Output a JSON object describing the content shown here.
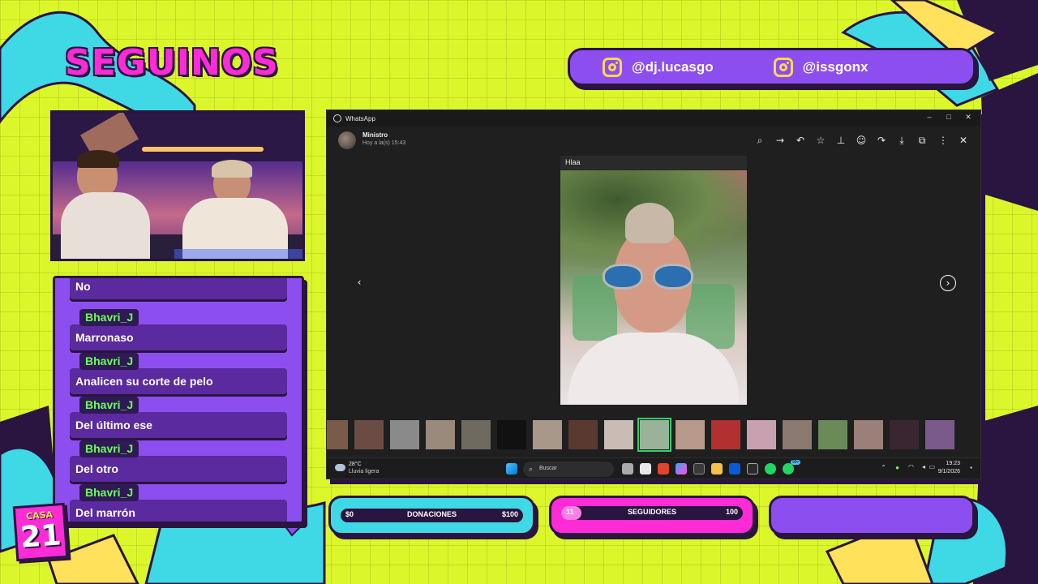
{
  "overlay": {
    "title": "SEGUINOS",
    "socials": [
      {
        "icon": "instagram-icon",
        "handle": "@dj.lucasgo"
      },
      {
        "icon": "instagram-icon",
        "handle": "@issgonx"
      }
    ],
    "logo": {
      "top": "CASA",
      "number": "21"
    }
  },
  "chat": {
    "messages": [
      {
        "user": "",
        "text": "No"
      },
      {
        "user": "Bhavri_J",
        "text": "Marronaso"
      },
      {
        "user": "Bhavri_J",
        "text": "Analicen su corte de pelo"
      },
      {
        "user": "Bhavri_J",
        "text": "Del último ese"
      },
      {
        "user": "Bhavri_J",
        "text": "Del otro"
      },
      {
        "user": "Bhavri_J",
        "text": "Del marrón"
      }
    ]
  },
  "whatsapp": {
    "window_title": "WhatsApp",
    "window_controls": {
      "minimize": "–",
      "maximize": "□",
      "close": "✕"
    },
    "contact_name": "Ministro",
    "timestamp": "Hoy a la(s) 15:43",
    "caption": "Hlaa",
    "toolbar_icons": [
      "zoom-in-icon",
      "forward-arrow-icon",
      "reply-icon",
      "star-icon",
      "pin-icon",
      "emoji-icon",
      "forward-icon",
      "download-icon",
      "open-external-icon",
      "more-options-icon",
      "close-icon"
    ],
    "nav": {
      "prev": "‹",
      "next": "›"
    },
    "selected_thumb_index": 9
  },
  "taskbar": {
    "weather_temp": "28°C",
    "weather_desc": "Lluvia ligera",
    "search_placeholder": "Buscar",
    "time": "19:23",
    "date": "9/1/2026",
    "badge": "99+"
  },
  "goals": {
    "donations": {
      "label": "DONACIONES",
      "min": "$0",
      "max": "$100",
      "progress": 0
    },
    "followers": {
      "label": "SEGUIDORES",
      "min": "11",
      "max": "100",
      "progress": 0.11
    }
  },
  "colors": {
    "background": "#dbf72c",
    "accent_purple": "#8d4ef0",
    "accent_pink": "#ff2bd6",
    "accent_cyan": "#3fd9e6",
    "outline": "#2a1440",
    "chat_user": "#6dff5c"
  }
}
